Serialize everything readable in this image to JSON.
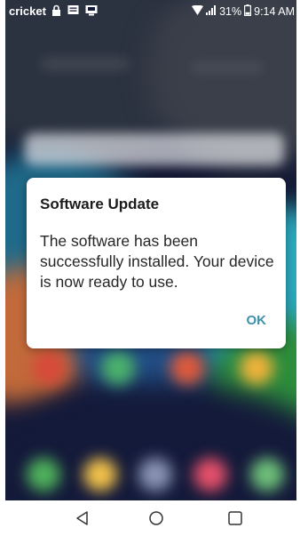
{
  "status_bar": {
    "carrier": "cricket",
    "battery_percent": "31%",
    "time": "9:14 AM",
    "icons": [
      "lock-icon",
      "message-icon",
      "screen-icon",
      "wifi-icon",
      "signal-icon",
      "battery-icon"
    ]
  },
  "dialog": {
    "title": "Software Update",
    "message": "The software has been successfully installed. Your device is now ready to use.",
    "ok_label": "OK"
  },
  "nav_bar": {
    "buttons": [
      "back-icon",
      "home-icon",
      "recents-icon"
    ]
  },
  "colors": {
    "dialog_background": "#ffffff",
    "accent": "#3e8fa8",
    "nav_background": "#ffffff"
  }
}
